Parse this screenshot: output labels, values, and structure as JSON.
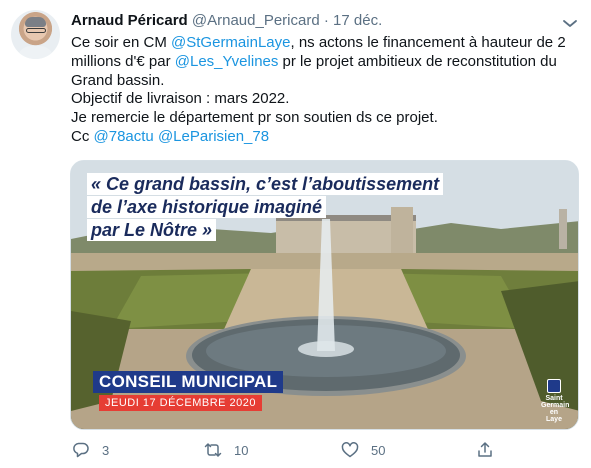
{
  "tweet": {
    "author_name": "Arnaud Péricard",
    "handle": "@Arnaud_Pericard",
    "separator": "·",
    "date": "17 déc.",
    "text": {
      "l1_a": "Ce soir en CM ",
      "l1_link": "@StGermainLaye",
      "l1_b": ", ns actons le financement à hauteur de 2",
      "l2_a": "millions d'€ par ",
      "l2_link": "@Les_Yvelines",
      "l2_b": " pr le projet ambitieux de reconstitution du",
      "l3": "Grand bassin.",
      "l4": "Objectif de livraison : mars 2022.",
      "l5": "Je remercie le département pr son soutien ds ce projet.",
      "l6_a": "Cc ",
      "l6_link1": "@78actu",
      "l6_sep": " ",
      "l6_link2": "@LeParisien_78"
    }
  },
  "media": {
    "quote_line1": "« Ce grand bassin, c’est l’aboutissement",
    "quote_line2": "de l’axe historique imaginé",
    "quote_line3": "par Le Nôtre »",
    "banner_title": "CONSEIL MUNICIPAL",
    "banner_date": "JEUDI 17 DÉCEMBRE 2020",
    "logo_line1": "Saint",
    "logo_line2": "Germain",
    "logo_line3": "en Laye"
  },
  "actions": {
    "reply_count": "3",
    "retweet_count": "10",
    "like_count": "50",
    "share_count": ""
  },
  "colors": {
    "link": "#1b95e0",
    "muted": "#5b7083",
    "banner_blue": "#1f3a8a",
    "banner_red": "#e63d34"
  },
  "icons": [
    "more-icon",
    "reply-icon",
    "retweet-icon",
    "like-icon",
    "share-icon"
  ]
}
